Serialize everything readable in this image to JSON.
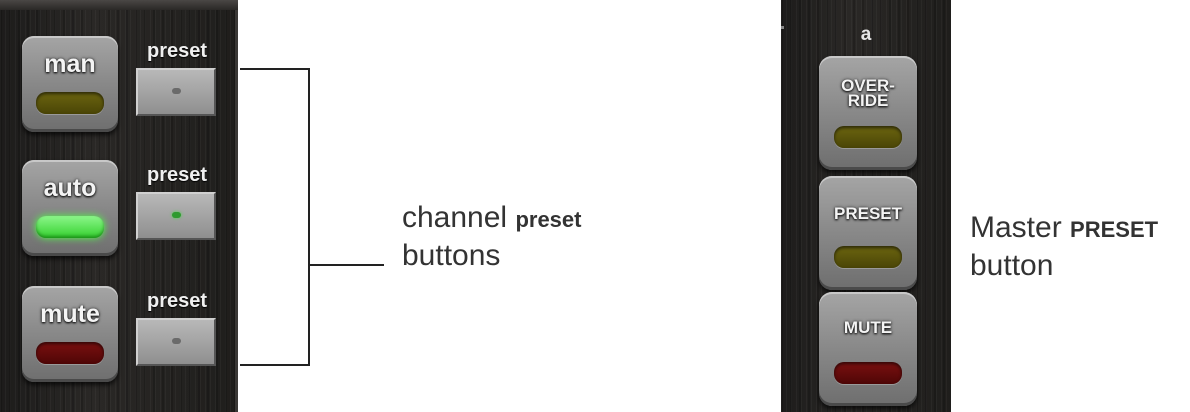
{
  "channel": {
    "rows": [
      {
        "label": "man",
        "led_color": "#5a5408",
        "preset_label": "preset",
        "preset_lit": false
      },
      {
        "label": "auto",
        "led_color": "#3ee03a",
        "preset_label": "preset",
        "preset_lit": true
      },
      {
        "label": "mute",
        "led_color": "#6a0b0b",
        "preset_label": "preset",
        "preset_lit": false
      }
    ]
  },
  "master": {
    "title": "a",
    "buttons": [
      {
        "label_line1": "OVER-",
        "label_line2": "RIDE",
        "led_color": "#5a5408"
      },
      {
        "label_line1": "PRESET",
        "label_line2": "",
        "led_color": "#5a5408"
      },
      {
        "label_line1": "MUTE",
        "label_line2": "",
        "led_color": "#6a0b0b"
      }
    ]
  },
  "callouts": {
    "channel": {
      "text1": "channel ",
      "text_em": "preset",
      "text2": "buttons"
    },
    "master": {
      "text1": "Master ",
      "text_em": "PRESET",
      "text2": "button"
    }
  },
  "colors": {
    "led_green": "#3ee03a",
    "led_yellow_off": "#5a5408",
    "led_red_off": "#6a0b0b",
    "preset_dot_lit": "#2e9a2e"
  }
}
